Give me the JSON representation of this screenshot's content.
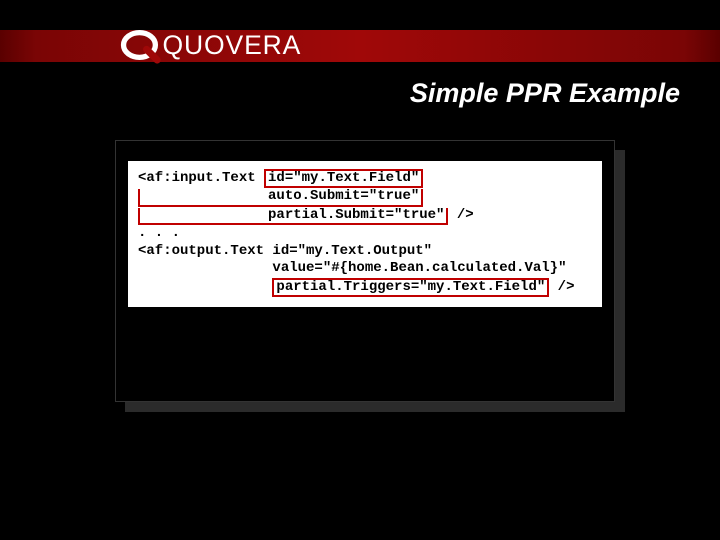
{
  "logo_text": "QUOVERA",
  "title": "Simple PPR Example",
  "code": {
    "l1a": "<af:input.Text ",
    "l1b": "id=\"my.Text.Field\"",
    "l2": "               auto.Submit=\"true\"",
    "l3a": "               partial.Submit=\"true\"",
    "l3b": " />",
    "l4": ". . .",
    "l5": "<af:output.Text id=\"my.Text.Output\"",
    "l6": "                value=\"#{home.Bean.calculated.Val}\"",
    "l7a": "                ",
    "l7b": "partial.Triggers=\"my.Text.Field\"",
    "l7c": " />"
  }
}
